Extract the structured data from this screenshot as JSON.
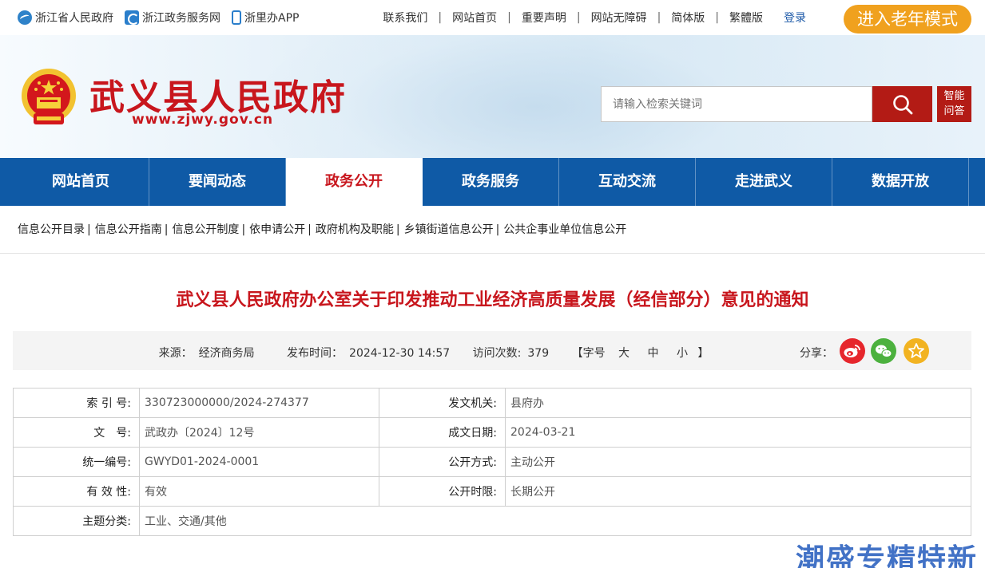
{
  "topbar": {
    "left_links": [
      {
        "label": "浙江省人民政府",
        "icon": "globe-icon"
      },
      {
        "label": "浙江政务服务网",
        "icon": "zjzw-icon"
      },
      {
        "label": "浙里办APP",
        "icon": "phone-icon"
      }
    ],
    "right_links": [
      "联系我们",
      "网站首页",
      "重要声明",
      "网站无障碍",
      "简体版",
      "繁體版"
    ],
    "login": "登录",
    "elder_mode": "进入老年模式"
  },
  "header": {
    "site_title": "武义县人民政府",
    "site_url": "www.zjwy.gov.cn",
    "search_placeholder": "请输入检索关键词",
    "ai_line1": "智能",
    "ai_line2": "问答"
  },
  "nav": {
    "items": [
      "网站首页",
      "要闻动态",
      "政务公开",
      "政务服务",
      "互动交流",
      "走进武义",
      "数据开放"
    ],
    "active": "政务公开"
  },
  "subnav": {
    "items": [
      "信息公开目录",
      "信息公开指南",
      "信息公开制度",
      "依申请公开",
      "政府机构及职能",
      "乡镇街道信息公开",
      "公共企事业单位信息公开"
    ]
  },
  "article": {
    "title": "武义县人民政府办公室关于印发推动工业经济高质量发展（经信部分）意见的通知",
    "source_label": "来源：",
    "source": "经济商务局",
    "date_label": "发布时间：",
    "date": "2024-12-30 14:57",
    "visits_label": "访问次数:",
    "visits": "379",
    "fontsize_label": "【字号",
    "font_large": "大",
    "font_medium": "中",
    "font_small": "小",
    "fontsize_close": "】",
    "share_label": "分享："
  },
  "info": {
    "rows": [
      {
        "k1": "索 引 号:",
        "v1": "330723000000/2024-274377",
        "k2": "发文机关:",
        "v2": "县府办"
      },
      {
        "k1": "文　号:",
        "v1": "武政办〔2024〕12号",
        "k2": "成文日期:",
        "v2": "2024-03-21"
      },
      {
        "k1": "统一编号:",
        "v1": "GWYD01-2024-0001",
        "k2": "公开方式:",
        "v2": "主动公开"
      },
      {
        "k1": "有 效 性:",
        "v1": "有效",
        "k2": "公开时限:",
        "v2": "长期公开"
      },
      {
        "k1": "主题分类:",
        "v1": "工业、交通/其他"
      }
    ]
  },
  "watermark": "潮盛专精特新",
  "colors": {
    "brand_red": "#c8161d",
    "nav_blue": "#0f5aa6",
    "elder_orange": "#f0a11e"
  }
}
